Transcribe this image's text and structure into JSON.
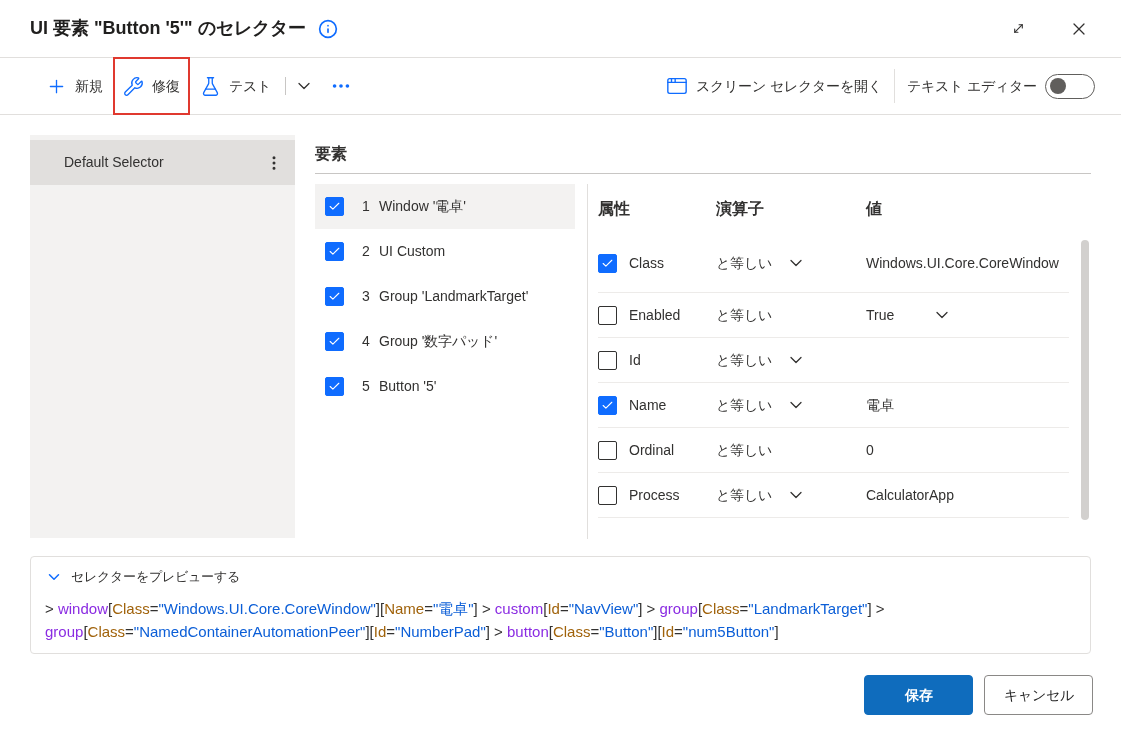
{
  "window": {
    "title": "UI 要素 \"Button '5'\" のセレクター"
  },
  "toolbar": {
    "items": [
      {
        "kind": "add",
        "label": "新規",
        "highlighted": false
      },
      {
        "kind": "repair",
        "label": "修復",
        "highlighted": true
      },
      {
        "kind": "test",
        "label": "テスト",
        "highlighted": false
      }
    ],
    "screen_selector": "スクリーン セレクターを開く",
    "text_editor": {
      "label": "テキスト エディター",
      "on": false
    }
  },
  "selectors": [
    {
      "label": "Default Selector",
      "selected": true
    }
  ],
  "elements": {
    "heading": "要素",
    "items": [
      {
        "index": "1",
        "label": "Window '電卓'",
        "checked": true,
        "selected": true
      },
      {
        "index": "2",
        "label": "UI Custom",
        "checked": true,
        "selected": false
      },
      {
        "index": "3",
        "label": "Group 'LandmarkTarget'",
        "checked": true,
        "selected": false
      },
      {
        "index": "4",
        "label": "Group '数字パッド'",
        "checked": true,
        "selected": false
      },
      {
        "index": "5",
        "label": "Button '5'",
        "checked": true,
        "selected": false
      }
    ]
  },
  "attributes": {
    "columns": [
      "属性",
      "演算子",
      "値"
    ],
    "rows": [
      {
        "name": "Class",
        "checked": true,
        "operator": "と等しい",
        "operator_dropdown": true,
        "value": "Windows.UI.Core.CoreWindow",
        "value_dropdown": false
      },
      {
        "name": "Enabled",
        "checked": false,
        "operator": "と等しい",
        "operator_dropdown": false,
        "value": "True",
        "value_dropdown": true
      },
      {
        "name": "Id",
        "checked": false,
        "operator": "と等しい",
        "operator_dropdown": true,
        "value_dropdown": false
      },
      {
        "name": "Name",
        "checked": true,
        "operator": "と等しい",
        "operator_dropdown": true,
        "value": "電卓",
        "value_dropdown": false
      },
      {
        "name": "Ordinal",
        "checked": false,
        "operator": "と等しい",
        "operator_dropdown": false,
        "value": "0",
        "value_dropdown": false
      },
      {
        "name": "Process",
        "checked": false,
        "operator": "と等しい",
        "operator_dropdown": true,
        "value": "CalculatorApp",
        "value_dropdown": false
      }
    ]
  },
  "preview": {
    "title": "セレクターをプレビューする",
    "expanded": true,
    "tokens": [
      {
        "kind": "plain",
        "text": "> "
      },
      {
        "kind": "func",
        "text": "window"
      },
      {
        "kind": "plain",
        "text": "["
      },
      {
        "kind": "attr",
        "text": "Class"
      },
      {
        "kind": "plain",
        "text": "="
      },
      {
        "kind": "value",
        "text": "\"Windows.UI.Core.CoreWindow\""
      },
      {
        "kind": "plain",
        "text": "]["
      },
      {
        "kind": "attr",
        "text": "Name"
      },
      {
        "kind": "plain",
        "text": "="
      },
      {
        "kind": "value",
        "text": "\"電卓\""
      },
      {
        "kind": "plain",
        "text": "] > "
      },
      {
        "kind": "func",
        "text": "custom"
      },
      {
        "kind": "plain",
        "text": "["
      },
      {
        "kind": "attr",
        "text": "Id"
      },
      {
        "kind": "plain",
        "text": "="
      },
      {
        "kind": "value",
        "text": "\"NavView\""
      },
      {
        "kind": "plain",
        "text": "] > "
      },
      {
        "kind": "func",
        "text": "group"
      },
      {
        "kind": "plain",
        "text": "["
      },
      {
        "kind": "attr",
        "text": "Class"
      },
      {
        "kind": "plain",
        "text": "="
      },
      {
        "kind": "value",
        "text": "\"LandmarkTarget\""
      },
      {
        "kind": "plain",
        "text": "] > "
      },
      {
        "kind": "func",
        "text": "group"
      },
      {
        "kind": "plain",
        "text": "["
      },
      {
        "kind": "attr",
        "text": "Class"
      },
      {
        "kind": "plain",
        "text": "="
      },
      {
        "kind": "value",
        "text": "\"NamedContainerAutomationPeer\""
      },
      {
        "kind": "plain",
        "text": "]["
      },
      {
        "kind": "attr",
        "text": "Id"
      },
      {
        "kind": "plain",
        "text": "="
      },
      {
        "kind": "value",
        "text": "\"NumberPad\""
      },
      {
        "kind": "plain",
        "text": "] > "
      },
      {
        "kind": "func",
        "text": "button"
      },
      {
        "kind": "plain",
        "text": "["
      },
      {
        "kind": "attr",
        "text": "Class"
      },
      {
        "kind": "plain",
        "text": "="
      },
      {
        "kind": "value",
        "text": "\"Button\""
      },
      {
        "kind": "plain",
        "text": "]["
      },
      {
        "kind": "attr",
        "text": "Id"
      },
      {
        "kind": "plain",
        "text": "="
      },
      {
        "kind": "value",
        "text": "\"num5Button\""
      },
      {
        "kind": "plain",
        "text": "]"
      }
    ]
  },
  "buttons": [
    {
      "kind": "primary",
      "label": "保存"
    },
    {
      "kind": "secondary",
      "label": "キャンセル"
    }
  ]
}
